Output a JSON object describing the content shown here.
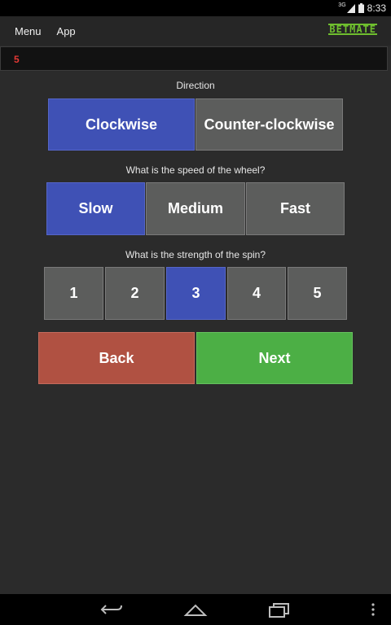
{
  "status_bar": {
    "network": "3G",
    "time": "8:33"
  },
  "action_bar": {
    "menu_label": "Menu",
    "app_label": "App",
    "logo_text": "BETMATE",
    "logo_color": "#6fbf2e"
  },
  "value_display": {
    "value": "5",
    "color": "#e53935"
  },
  "direction": {
    "label": "Direction",
    "options": [
      "Clockwise",
      "Counter-clockwise"
    ],
    "selected": "Clockwise"
  },
  "speed": {
    "label": "What is the speed of the wheel?",
    "options": [
      "Slow",
      "Medium",
      "Fast"
    ],
    "selected": "Slow"
  },
  "strength": {
    "label": "What is the strength of the spin?",
    "options": [
      "1",
      "2",
      "3",
      "4",
      "5"
    ],
    "selected": "3"
  },
  "actions": {
    "back_label": "Back",
    "next_label": "Next"
  },
  "colors": {
    "selected": "#3f51b5",
    "unselected": "#5c5d5c",
    "back": "#b05142",
    "next": "#4caf45"
  },
  "icons": {
    "status": [
      "signal-icon",
      "battery-icon"
    ],
    "nav": [
      "back-nav-icon",
      "home-nav-icon",
      "recents-nav-icon",
      "overflow-menu-icon"
    ]
  }
}
